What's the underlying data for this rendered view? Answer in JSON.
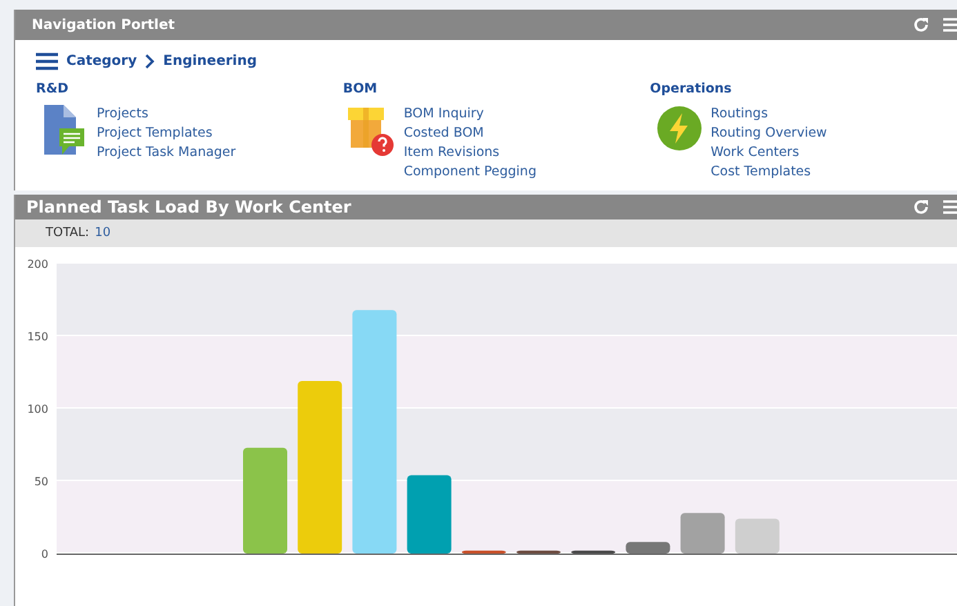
{
  "nav_portlet": {
    "title": "Navigation Portlet",
    "breadcrumb": [
      "Category",
      "Engineering"
    ],
    "groups": [
      {
        "title": "R&D",
        "links": [
          "Projects",
          "Project Templates",
          "Project Task Manager"
        ]
      },
      {
        "title": "BOM",
        "links": [
          "BOM Inquiry",
          "Costed BOM",
          "Item Revisions",
          "Component Pegging"
        ]
      },
      {
        "title": "Operations",
        "links": [
          "Routings",
          "Routing Overview",
          "Work Centers",
          "Cost Templates"
        ]
      }
    ]
  },
  "chart_portlet": {
    "title": "Planned Task Load By Work Center",
    "total_label": "TOTAL:",
    "total_value": "10",
    "chart_data": {
      "type": "bar",
      "yticks": [
        0,
        50,
        100,
        150,
        200
      ],
      "ylim": [
        0,
        200
      ],
      "values": [
        null,
        null,
        null,
        73,
        119,
        168,
        54,
        2,
        2,
        2,
        8,
        28,
        24,
        null,
        null,
        null
      ],
      "colors": [
        null,
        null,
        null,
        "#8bc34a",
        "#eccc0c",
        "#87d9f5",
        "#00a0b0",
        "#c8502a",
        "#6d4c41",
        "#4a4a4a",
        "#777777",
        "#a2a2a2",
        "#cfcfcf",
        null,
        null,
        null
      ]
    }
  }
}
